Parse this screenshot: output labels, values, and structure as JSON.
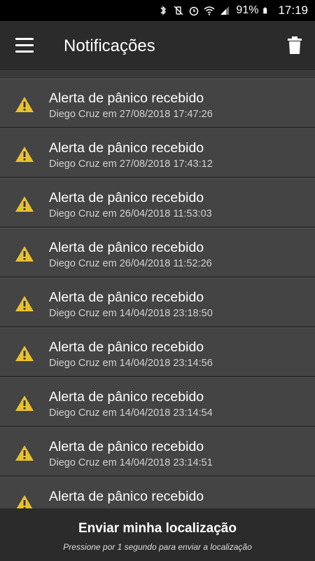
{
  "status_bar": {
    "battery": "91%",
    "time": "17:19",
    "icons": [
      "bluetooth-icon",
      "vibrate-mute-icon",
      "alarm-icon",
      "wifi-icon",
      "signal-icon",
      "battery-icon"
    ]
  },
  "app_bar": {
    "title": "Notificações",
    "menu_icon": "hamburger-menu-icon",
    "delete_icon": "trash-icon"
  },
  "notifications": [
    {
      "title": "Alerta de pânico recebido",
      "detail": "Diego Cruz em 27/08/2018 17:47:26"
    },
    {
      "title": "Alerta de pânico recebido",
      "detail": "Diego Cruz em 27/08/2018 17:43:12"
    },
    {
      "title": "Alerta de pânico recebido",
      "detail": "Diego Cruz em 26/04/2018 11:53:03"
    },
    {
      "title": "Alerta de pânico recebido",
      "detail": "Diego Cruz em 26/04/2018 11:52:26"
    },
    {
      "title": "Alerta de pânico recebido",
      "detail": "Diego Cruz em 14/04/2018 23:18:50"
    },
    {
      "title": "Alerta de pânico recebido",
      "detail": "Diego Cruz em 14/04/2018 23:14:56"
    },
    {
      "title": "Alerta de pânico recebido",
      "detail": "Diego Cruz em 14/04/2018 23:14:54"
    },
    {
      "title": "Alerta de pânico recebido",
      "detail": "Diego Cruz em 14/04/2018 23:14:51"
    },
    {
      "title": "Alerta de pânico recebido",
      "detail": ""
    }
  ],
  "bottom_bar": {
    "title": "Enviar minha localização",
    "subtitle": "Pressione por 1 segundo para enviar a localização"
  },
  "colors": {
    "warning": "#e8c12d",
    "item_bg": "#444444",
    "bar_bg": "#2b2b2b"
  }
}
